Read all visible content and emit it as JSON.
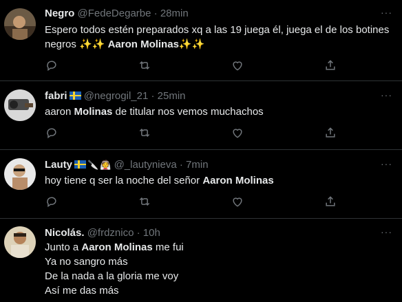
{
  "tweets": [
    {
      "name": "Negro",
      "handle": "@FedeDegarbe",
      "time": "28min",
      "lines": [
        {
          "pre": "Espero todos estén preparados xq a las 19 juega él, juega el de los botines",
          "bold": "",
          "post": ""
        },
        {
          "pre": "negros ✨✨ ",
          "bold": "Aaron Molinas",
          "post": "✨✨"
        }
      ]
    },
    {
      "name": "fabri",
      "handle": "@negrogil_21",
      "time": "25min",
      "lines": [
        {
          "pre": "aaron ",
          "bold": "Molinas",
          "post": " de titular nos vemos muchachos"
        }
      ]
    },
    {
      "name": "Lauty",
      "handle": "@_lautynieva",
      "time": "7min",
      "lines": [
        {
          "pre": "hoy tiene q ser la noche del señor ",
          "bold": "Aaron Molinas",
          "post": ""
        }
      ]
    },
    {
      "name": "Nicolás.",
      "handle": "@frdznico",
      "time": "10h",
      "lines": [
        {
          "pre": "Junto a ",
          "bold": "Aaron Molinas",
          "post": " me fui"
        },
        {
          "pre": "Ya no sangro más",
          "bold": "",
          "post": ""
        },
        {
          "pre": "De la nada a la gloria me voy",
          "bold": "",
          "post": ""
        },
        {
          "pre": "Así me das más",
          "bold": "",
          "post": ""
        }
      ]
    }
  ],
  "separator": "·",
  "more_label": "···",
  "colors": {
    "background": "#000000",
    "text": "#e7e9ea",
    "muted": "#71767b",
    "border": "#2f3336"
  },
  "icons": [
    "reply-icon",
    "retweet-icon",
    "like-icon",
    "share-icon",
    "more-icon",
    "sweden-flag-icon",
    "knife-icon",
    "bride-icon"
  ]
}
